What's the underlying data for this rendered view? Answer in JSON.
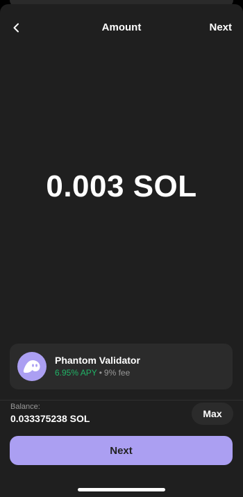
{
  "header": {
    "title": "Amount",
    "next_label": "Next",
    "back_icon": "chevron-left-icon"
  },
  "amount": {
    "display": "0.003 SOL"
  },
  "validator": {
    "name": "Phantom Validator",
    "apy": "6.95% APY",
    "separator": "•",
    "fee": "9% fee",
    "avatar_icon": "phantom-ghost-icon"
  },
  "balance": {
    "label": "Balance:",
    "value": "0.033375238 SOL"
  },
  "actions": {
    "max_label": "Max",
    "next_label": "Next"
  },
  "colors": {
    "background": "#1f1f1f",
    "card": "#2b2b2b",
    "accent": "#ab9ff2",
    "apy_green": "#21b367",
    "muted_text": "#999999"
  }
}
